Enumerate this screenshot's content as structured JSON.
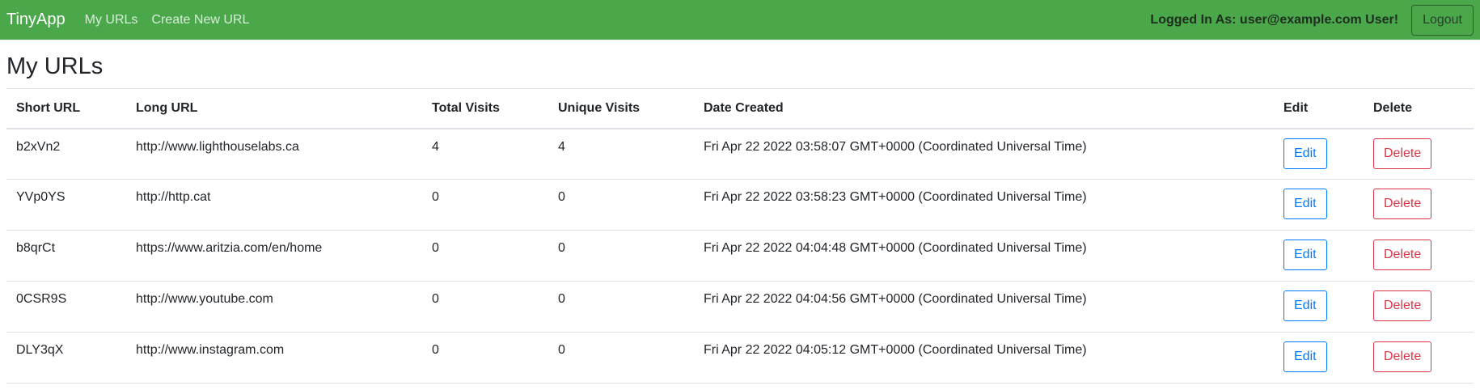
{
  "navbar": {
    "brand": "TinyApp",
    "links": [
      "My URLs",
      "Create New URL"
    ],
    "logged_in_text": "Logged In As: user@example.com User!",
    "logout_label": "Logout"
  },
  "page": {
    "title": "My URLs"
  },
  "table": {
    "headers": [
      "Short URL",
      "Long URL",
      "Total Visits",
      "Unique Visits",
      "Date Created",
      "Edit",
      "Delete"
    ],
    "rows": [
      {
        "short": "b2xVn2",
        "long": "http://www.lighthouselabs.ca",
        "total": "4",
        "unique": "4",
        "date": "Fri Apr 22 2022 03:58:07 GMT+0000 (Coordinated Universal Time)",
        "edit": "Edit",
        "delete": "Delete"
      },
      {
        "short": "YVp0YS",
        "long": "http://http.cat",
        "total": "0",
        "unique": "0",
        "date": "Fri Apr 22 2022 03:58:23 GMT+0000 (Coordinated Universal Time)",
        "edit": "Edit",
        "delete": "Delete"
      },
      {
        "short": "b8qrCt",
        "long": "https://www.aritzia.com/en/home",
        "total": "0",
        "unique": "0",
        "date": "Fri Apr 22 2022 04:04:48 GMT+0000 (Coordinated Universal Time)",
        "edit": "Edit",
        "delete": "Delete"
      },
      {
        "short": "0CSR9S",
        "long": "http://www.youtube.com",
        "total": "0",
        "unique": "0",
        "date": "Fri Apr 22 2022 04:04:56 GMT+0000 (Coordinated Universal Time)",
        "edit": "Edit",
        "delete": "Delete"
      },
      {
        "short": "DLY3qX",
        "long": "http://www.instagram.com",
        "total": "0",
        "unique": "0",
        "date": "Fri Apr 22 2022 04:05:12 GMT+0000 (Coordinated Universal Time)",
        "edit": "Edit",
        "delete": "Delete"
      }
    ]
  },
  "colors": {
    "navbar_bg": "#4aa84b",
    "edit": "#007bff",
    "delete": "#dc3545"
  }
}
